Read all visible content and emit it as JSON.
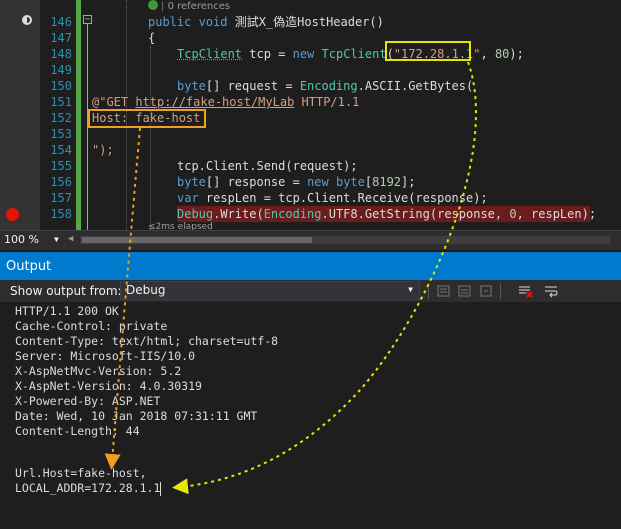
{
  "editor": {
    "codelens": "0 references",
    "line_numbers": [
      "146",
      "147",
      "148",
      "149",
      "150",
      "151",
      "152",
      "153",
      "154",
      "155",
      "156",
      "157",
      "158"
    ],
    "code": {
      "l146_kw1": "public",
      "l146_kw2": "void",
      "l146_name": "測試X_偽造HostHeader()",
      "l147": "{",
      "l148_type": "TcpClient",
      "l148_var": " tcp = ",
      "l148_new": "new",
      "l148_type2": "TcpClient",
      "l148_open": "(",
      "l148_ip": "\"172.28.1.1\"",
      "l148_sep": ", ",
      "l148_port": "80",
      "l148_close": ");",
      "l150_kw": "byte",
      "l150_rest": "[] request = ",
      "l150_type": "Encoding",
      "l150_end": ".ASCII.GetBytes(",
      "l151_prefix": "@\"GET ",
      "l151_url": "http://fake-host/MyLab",
      "l151_suffix": " HTTP/1.1",
      "l152": "Host: fake-host",
      "l154": "\");",
      "l155": "tcp.Client.Send(request);",
      "l156_kw": "byte",
      "l156_rest1": "[] response = ",
      "l156_new": "new",
      "l156_kw2": "byte",
      "l156_open": "[",
      "l156_num": "8192",
      "l156_close": "];",
      "l157_kw": "var",
      "l157_rest": " respLen = tcp.Client.Receive(response);",
      "l158_type1": "Debug",
      "l158_mid": ".Write(",
      "l158_type2": "Encoding",
      "l158_mid2": ".UTF8.GetString(response, ",
      "l158_num": "0",
      "l158_end": ", respLen);"
    },
    "perf_tip": "≤2ms elapsed"
  },
  "zoom": {
    "value": "100 %"
  },
  "output": {
    "title": "Output",
    "show_output_from_label": "Show output from:",
    "source_value": "Debug",
    "lines": [
      "HTTP/1.1 200 OK",
      "Cache-Control: private",
      "Content-Type: text/html; charset=utf-8",
      "Server: Microsoft-IIS/10.0",
      "X-AspNetMvc-Version: 5.2",
      "X-AspNet-Version: 4.0.30319",
      "X-Powered-By: ASP.NET",
      "Date: Wed, 10 Jan 2018 07:31:11 GMT",
      "Content-Length: 44",
      "",
      "",
      "Url.Host=fake-host,",
      "LOCAL_ADDR=172.28.1.1"
    ]
  },
  "colors": {
    "accent": "#007acc",
    "ip_highlight": "#e6e600",
    "host_highlight": "#f0a020",
    "breakpoint": "#e51400"
  }
}
